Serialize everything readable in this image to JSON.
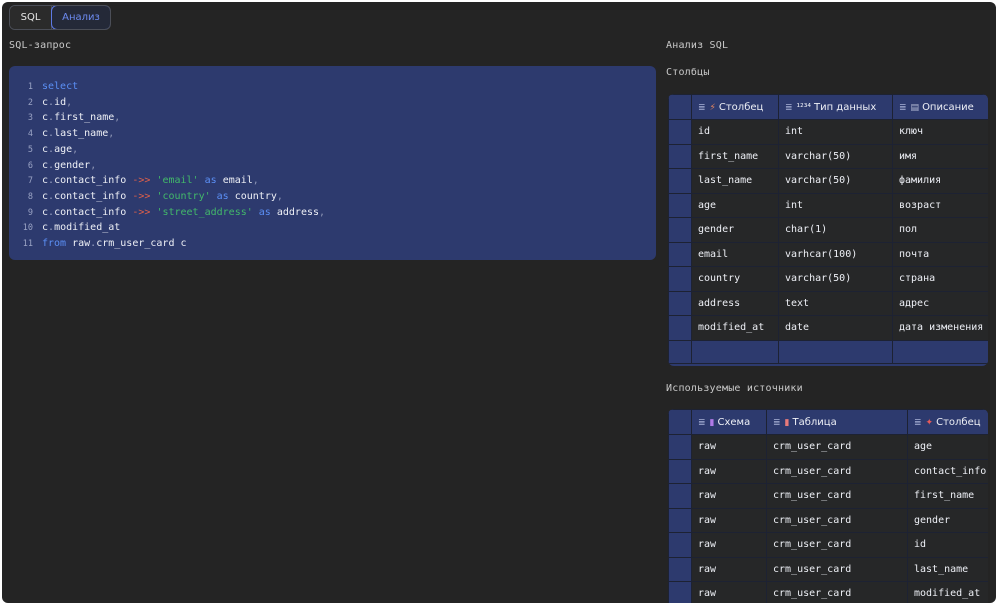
{
  "tabs": [
    {
      "label": "SQL",
      "active": false
    },
    {
      "label": "Анализ",
      "active": true
    }
  ],
  "left": {
    "title": "SQL-запрос"
  },
  "right": {
    "title": "Анализ SQL",
    "columns_title": "Столбцы",
    "sources_title": "Используемые источники"
  },
  "editor": {
    "line_numbers": [
      "1",
      "2",
      "3",
      "4",
      "5",
      "6",
      "7",
      "8",
      "9",
      "10",
      "11"
    ],
    "lines": [
      [
        {
          "t": "select",
          "c": "kw"
        }
      ],
      [
        {
          "t": "c",
          "c": "id"
        },
        {
          "t": ".",
          "c": "dot"
        },
        {
          "t": "id",
          "c": "id"
        },
        {
          "t": ",",
          "c": "cm"
        }
      ],
      [
        {
          "t": "c",
          "c": "id"
        },
        {
          "t": ".",
          "c": "dot"
        },
        {
          "t": "first_name",
          "c": "id"
        },
        {
          "t": ",",
          "c": "cm"
        }
      ],
      [
        {
          "t": "c",
          "c": "id"
        },
        {
          "t": ".",
          "c": "dot"
        },
        {
          "t": "last_name",
          "c": "id"
        },
        {
          "t": ",",
          "c": "cm"
        }
      ],
      [
        {
          "t": "c",
          "c": "id"
        },
        {
          "t": ".",
          "c": "dot"
        },
        {
          "t": "age",
          "c": "id"
        },
        {
          "t": ",",
          "c": "cm"
        }
      ],
      [
        {
          "t": "c",
          "c": "id"
        },
        {
          "t": ".",
          "c": "dot"
        },
        {
          "t": "gender",
          "c": "id"
        },
        {
          "t": ",",
          "c": "cm"
        }
      ],
      [
        {
          "t": "c",
          "c": "id"
        },
        {
          "t": ".",
          "c": "dot"
        },
        {
          "t": "contact_info ",
          "c": "id"
        },
        {
          "t": "->> ",
          "c": "op"
        },
        {
          "t": "'email'",
          "c": "str"
        },
        {
          "t": " as ",
          "c": "kw"
        },
        {
          "t": "email",
          "c": "id"
        },
        {
          "t": ",",
          "c": "cm"
        }
      ],
      [
        {
          "t": "c",
          "c": "id"
        },
        {
          "t": ".",
          "c": "dot"
        },
        {
          "t": "contact_info ",
          "c": "id"
        },
        {
          "t": "->> ",
          "c": "op"
        },
        {
          "t": "'country'",
          "c": "str"
        },
        {
          "t": " as ",
          "c": "kw"
        },
        {
          "t": "country",
          "c": "id"
        },
        {
          "t": ",",
          "c": "cm"
        }
      ],
      [
        {
          "t": "c",
          "c": "id"
        },
        {
          "t": ".",
          "c": "dot"
        },
        {
          "t": "contact_info ",
          "c": "id"
        },
        {
          "t": "->> ",
          "c": "op"
        },
        {
          "t": "'street_address'",
          "c": "str"
        },
        {
          "t": " as ",
          "c": "kw"
        },
        {
          "t": "address",
          "c": "id"
        },
        {
          "t": ",",
          "c": "cm"
        }
      ],
      [
        {
          "t": "c",
          "c": "id"
        },
        {
          "t": ".",
          "c": "dot"
        },
        {
          "t": "modified_at",
          "c": "id"
        }
      ],
      [
        {
          "t": "from ",
          "c": "kw"
        },
        {
          "t": "raw",
          "c": "id"
        },
        {
          "t": ".",
          "c": "dot"
        },
        {
          "t": "crm_user_card c",
          "c": "id"
        }
      ]
    ]
  },
  "columns_table": {
    "headers": [
      {
        "label": "Столбец",
        "icon": "lightning-icon",
        "icon_char": "⚡",
        "icon_color": "#f08a5d"
      },
      {
        "label": "Тип данных",
        "icon": "numeric-type-icon",
        "icon_char": "¹²³⁴",
        "icon_color": "#eef0f6"
      },
      {
        "label": "Описание",
        "icon": "document-icon",
        "icon_char": "▤",
        "icon_color": "#b8bfd8"
      }
    ],
    "rows": [
      [
        "id",
        "int",
        "ключ"
      ],
      [
        "first_name",
        "varchar(50)",
        "имя"
      ],
      [
        "last_name",
        "varchar(50)",
        "фамилия"
      ],
      [
        "age",
        "int",
        "возраст"
      ],
      [
        "gender",
        "char(1)",
        "пол"
      ],
      [
        "email",
        "varhcar(100)",
        "почта"
      ],
      [
        "country",
        "varchar(50)",
        "страна"
      ],
      [
        "address",
        "text",
        "адрес"
      ],
      [
        "modified_at",
        "date",
        "дата изменения"
      ]
    ]
  },
  "sources_table": {
    "headers": [
      {
        "label": "Схема",
        "icon": "schema-icon",
        "icon_char": "▮",
        "icon_color": "#b07ae8"
      },
      {
        "label": "Таблица",
        "icon": "table-icon",
        "icon_char": "▮",
        "icon_color": "#e87a7a"
      },
      {
        "label": "Столбец",
        "icon": "column-icon",
        "icon_char": "✦",
        "icon_color": "#e85a5a"
      }
    ],
    "rows": [
      [
        "raw",
        "crm_user_card",
        "age"
      ],
      [
        "raw",
        "crm_user_card",
        "contact_info"
      ],
      [
        "raw",
        "crm_user_card",
        "first_name"
      ],
      [
        "raw",
        "crm_user_card",
        "gender"
      ],
      [
        "raw",
        "crm_user_card",
        "id"
      ],
      [
        "raw",
        "crm_user_card",
        "last_name"
      ],
      [
        "raw",
        "crm_user_card",
        "modified_at"
      ]
    ]
  },
  "colors": {
    "background": "#242424",
    "panel": "#2d3a6e",
    "keyword": "#5b8ff5",
    "string": "#42b86a",
    "operator": "#e0604a",
    "active_tab": "#6c8af0"
  }
}
